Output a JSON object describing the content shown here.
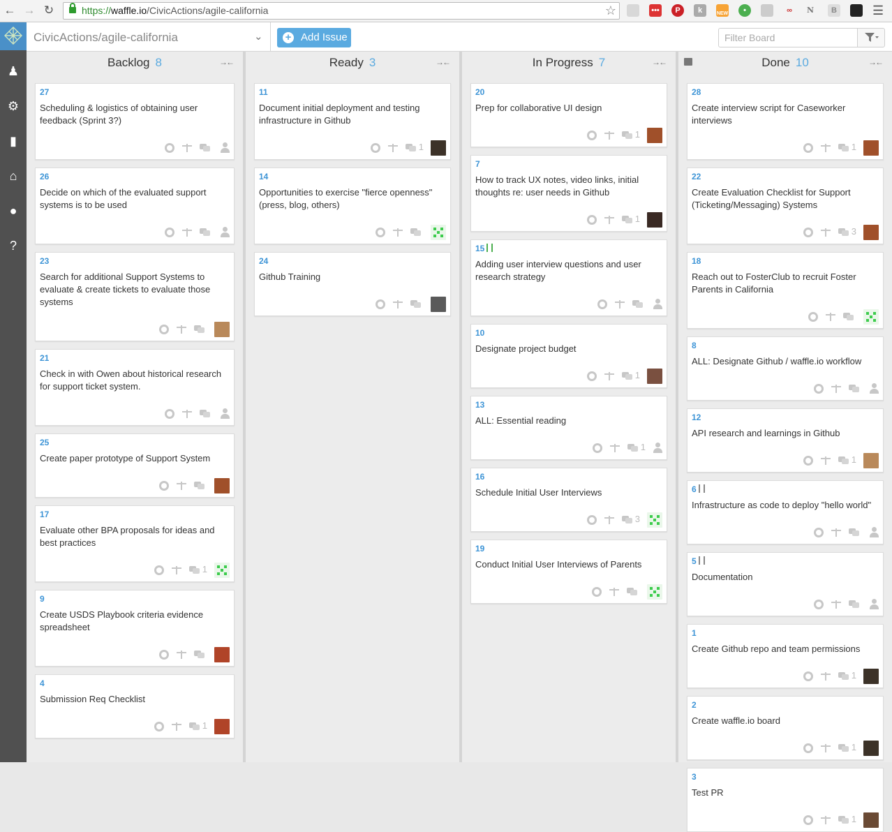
{
  "browser": {
    "url_scheme": "https://",
    "url_host": "waffle.io",
    "url_path": "/CivicActions/agile-california",
    "ext_new_badge": "NEW",
    "ext_n_letter": "N"
  },
  "header": {
    "repo": "CivicActions/agile-california",
    "add_issue": "Add Issue",
    "filter_placeholder": "Filter Board"
  },
  "colors": {
    "accent": "#5aaae0",
    "sidebar": "#505050",
    "issue_number": "#3d94d6"
  },
  "columns": [
    {
      "name": "Backlog",
      "count": "8",
      "cards": [
        {
          "num": "27",
          "title": "Scheduling & logistics of obtaining user feedback (Sprint 3?)",
          "comments": "",
          "assignee": "none"
        },
        {
          "num": "26",
          "title": "Decide on which of the evaluated support systems is to be used",
          "comments": "",
          "assignee": "none"
        },
        {
          "num": "23",
          "title": "Search for additional Support Systems to evaluate & create tickets to evaluate those systems",
          "comments": "",
          "assignee": "avatar-f1"
        },
        {
          "num": "21",
          "title": "Check in with Owen about historical research for support ticket system.",
          "comments": "",
          "assignee": "none"
        },
        {
          "num": "25",
          "title": "Create paper prototype of Support System",
          "comments": "",
          "assignee": "avatar-m2"
        },
        {
          "num": "17",
          "title": "Evaluate other BPA proposals for ideas and best practices",
          "comments": "1",
          "assignee": "identicon"
        },
        {
          "num": "9",
          "title": "Create USDS Playbook criteria evidence spreadsheet",
          "comments": "",
          "assignee": "avatar-m3"
        },
        {
          "num": "4",
          "title": "Submission Req Checklist",
          "comments": "1",
          "assignee": "avatar-m3"
        }
      ]
    },
    {
      "name": "Ready",
      "count": "3",
      "cards": [
        {
          "num": "11",
          "title": "Document initial deployment and testing infrastructure in Github",
          "comments": "1",
          "assignee": "avatar-m4"
        },
        {
          "num": "14",
          "title": "Opportunities to exercise \"fierce openness\" (press, blog, others)",
          "comments": "",
          "assignee": "identicon"
        },
        {
          "num": "24",
          "title": "Github Training",
          "comments": "",
          "assignee": "avatar-m5"
        }
      ]
    },
    {
      "name": "In Progress",
      "count": "7",
      "cards": [
        {
          "num": "20",
          "title": "Prep for collaborative UI design",
          "comments": "1",
          "assignee": "avatar-m2"
        },
        {
          "num": "7",
          "title": "How to track UX notes, video links, initial thoughts re: user needs in Github",
          "comments": "1",
          "assignee": "avatar-f2"
        },
        {
          "num": "15",
          "title": "Adding user interview questions and user research strategy",
          "comments": "",
          "assignee": "none",
          "pr": "green"
        },
        {
          "num": "10",
          "title": "Designate project budget",
          "comments": "1",
          "assignee": "avatar-f3"
        },
        {
          "num": "13",
          "title": "ALL: Essential reading",
          "comments": "1",
          "assignee": "none"
        },
        {
          "num": "16",
          "title": "Schedule Initial User Interviews",
          "comments": "3",
          "assignee": "identicon"
        },
        {
          "num": "19",
          "title": "Conduct Initial User Interviews of Parents",
          "comments": "",
          "assignee": "identicon"
        }
      ]
    },
    {
      "name": "Done",
      "count": "10",
      "cards": [
        {
          "num": "28",
          "title": "Create interview script for Caseworker interviews",
          "comments": "1",
          "assignee": "avatar-m2"
        },
        {
          "num": "22",
          "title": "Create Evaluation Checklist for Support (Ticketing/Messaging) Systems",
          "comments": "3",
          "assignee": "avatar-m2"
        },
        {
          "num": "18",
          "title": "Reach out to FosterClub to recruit Foster Parents in California",
          "comments": "",
          "assignee": "identicon"
        },
        {
          "num": "8",
          "title": "ALL: Designate Github / waffle.io workflow",
          "comments": "",
          "assignee": "none"
        },
        {
          "num": "12",
          "title": "API research and learnings in Github",
          "comments": "1",
          "assignee": "avatar-f1"
        },
        {
          "num": "6",
          "title": "Infrastructure as code to deploy \"hello world\"",
          "comments": "",
          "assignee": "none",
          "pr": "gray"
        },
        {
          "num": "5",
          "title": "Documentation",
          "comments": "",
          "assignee": "none",
          "pr": "gray"
        },
        {
          "num": "1",
          "title": "Create Github repo and team permissions",
          "comments": "1",
          "assignee": "avatar-m4"
        },
        {
          "num": "2",
          "title": "Create waffle.io board",
          "comments": "1",
          "assignee": "avatar-m4"
        },
        {
          "num": "3",
          "title": "Test PR",
          "comments": "1",
          "assignee": "avatar-m6"
        }
      ]
    }
  ]
}
